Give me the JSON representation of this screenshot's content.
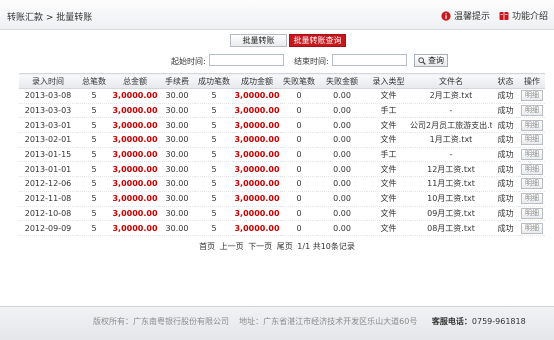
{
  "header": {
    "breadcrumb": "转账汇款 > 批量转账",
    "links": [
      {
        "label": "温馨提示",
        "icon": "info-icon",
        "color": "#c9171e"
      },
      {
        "label": "功能介绍",
        "icon": "book-icon",
        "color": "#c9171e"
      }
    ]
  },
  "tabs": [
    {
      "label": "批量转账",
      "active": false
    },
    {
      "label": "批量转账查询",
      "active": true
    }
  ],
  "filter": {
    "start_label": "起始时间:",
    "start_value": "",
    "end_label": "结束时间:",
    "end_value": "",
    "query_label": "查询",
    "query_icon": "search-icon"
  },
  "table": {
    "headers": [
      "录入时间",
      "总笔数",
      "总金额",
      "手续费",
      "成功笔数",
      "成功金额",
      "失败笔数",
      "失败金额",
      "录入类型",
      "文件名",
      "状态",
      "操作"
    ],
    "rows": [
      [
        "2013-03-08",
        "5",
        "3,0000.00",
        "30.00",
        "5",
        "3,0000.00",
        "0",
        "0.00",
        "文件",
        "2月工资.txt",
        "成功",
        "明细"
      ],
      [
        "2013-03-03",
        "5",
        "3,0000.00",
        "30.00",
        "5",
        "3,0000.00",
        "0",
        "0.00",
        "手工",
        "-",
        "成功",
        "明细"
      ],
      [
        "2013-03-01",
        "5",
        "3,0000.00",
        "30.00",
        "5",
        "3,0000.00",
        "0",
        "0.00",
        "文件",
        "公司2月员工旅游支出.txt",
        "成功",
        "明细"
      ],
      [
        "2013-02-01",
        "5",
        "3,0000.00",
        "30.00",
        "5",
        "3,0000.00",
        "0",
        "0.00",
        "文件",
        "1月工资.txt",
        "成功",
        "明细"
      ],
      [
        "2013-01-15",
        "5",
        "3,0000.00",
        "30.00",
        "5",
        "3,0000.00",
        "0",
        "0.00",
        "手工",
        "-",
        "成功",
        "明细"
      ],
      [
        "2013-01-01",
        "5",
        "3,0000.00",
        "30.00",
        "5",
        "3,0000.00",
        "0",
        "0.00",
        "文件",
        "12月工资.txt",
        "成功",
        "明细"
      ],
      [
        "2012-12-06",
        "5",
        "3,0000.00",
        "30.00",
        "5",
        "3,0000.00",
        "0",
        "0.00",
        "文件",
        "11月工资.txt",
        "成功",
        "明细"
      ],
      [
        "2012-11-08",
        "5",
        "3,0000.00",
        "30.00",
        "5",
        "3,0000.00",
        "0",
        "0.00",
        "文件",
        "10月工资.txt",
        "成功",
        "明细"
      ],
      [
        "2012-10-08",
        "5",
        "3,0000.00",
        "30.00",
        "5",
        "3,0000.00",
        "0",
        "0.00",
        "文件",
        "09月工资.txt",
        "成功",
        "明细"
      ],
      [
        "2012-09-09",
        "5",
        "3,0000.00",
        "30.00",
        "5",
        "3,0000.00",
        "0",
        "0.00",
        "文件",
        "08月工资.txt",
        "成功",
        "明细"
      ]
    ]
  },
  "pager": {
    "first": "首页",
    "prev": "上一页",
    "next": "下一页",
    "last": "尾页",
    "info": "1/1 共10条记录"
  },
  "footer": {
    "copyright": "版权所有：广东南粤银行股份有限公司",
    "address": "地址：广东省湛江市经济技术开发区乐山大道60号",
    "hotline_label": "客服电话：",
    "hotline": "0759-961818"
  },
  "colors": {
    "brand": "#c9171e",
    "amount": "#c40000"
  }
}
